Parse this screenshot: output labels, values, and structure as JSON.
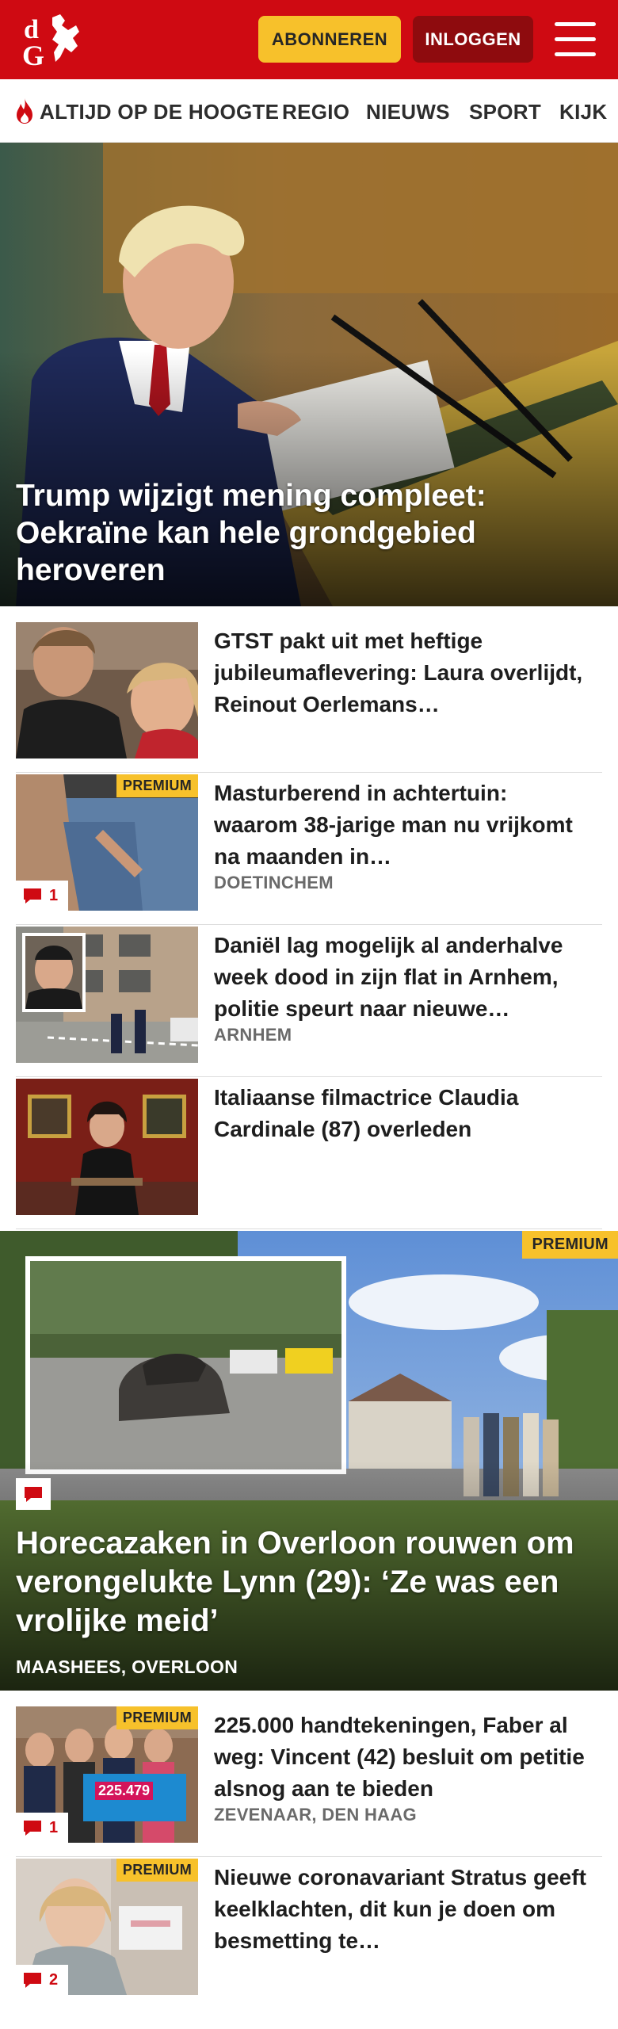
{
  "header": {
    "logo_text": "dG",
    "subscribe_label": "ABONNEREN",
    "login_label": "INLOGGEN"
  },
  "nav": {
    "items": [
      "ALTIJD OP DE HOOGTE",
      "REGIO",
      "NIEUWS",
      "SPORT",
      "KIJK"
    ]
  },
  "hero": {
    "title": "Trump wijzigt mening compleet: Oekraïne kan hele grondgebied heroveren"
  },
  "stories": [
    {
      "title": "GTST pakt uit met heftige jubileumaflevering: Laura overlijdt, Reinout Oerlemans…",
      "location": "",
      "premium": false,
      "comments": ""
    },
    {
      "title": "Masturberend in achtertuin: waarom 38-jarige man nu vrijkomt na maanden in…",
      "location": "DOETINCHEM",
      "premium": true,
      "comments": "1"
    },
    {
      "title": "Daniël lag mogelijk al anderhalve week dood in zijn flat in Arnhem, politie speurt naar nieuwe…",
      "location": "ARNHEM",
      "premium": false,
      "comments": ""
    },
    {
      "title": "Italiaanse filmactrice Claudia Cardinale (87) overleden",
      "location": "",
      "premium": false,
      "comments": ""
    }
  ],
  "feature": {
    "badge": "PREMIUM",
    "title": "Horecazaken in Overloon rouwen om verongelukte Lynn (29): ‘Ze was een vrolijke meid’",
    "location": "MAASHEES, OVERLOON"
  },
  "stories2": [
    {
      "title": "225.000 handtekeningen, Faber al weg: Vincent (42) besluit om petitie alsnog aan te bieden",
      "location": "ZEVENAAR, DEN HAAG",
      "premium": true,
      "comments": "1",
      "sign_text": "225.479"
    },
    {
      "title": "Nieuwe coronavariant Stratus geeft keelklachten, dit kun je doen om besmetting te…",
      "location": "",
      "premium": true,
      "comments": "2"
    }
  ],
  "premium_label": "PREMIUM",
  "colors": {
    "brand_red": "#cf0a12",
    "premium_yellow": "#f7c12b",
    "login_dark_red": "#8e0b0e"
  }
}
